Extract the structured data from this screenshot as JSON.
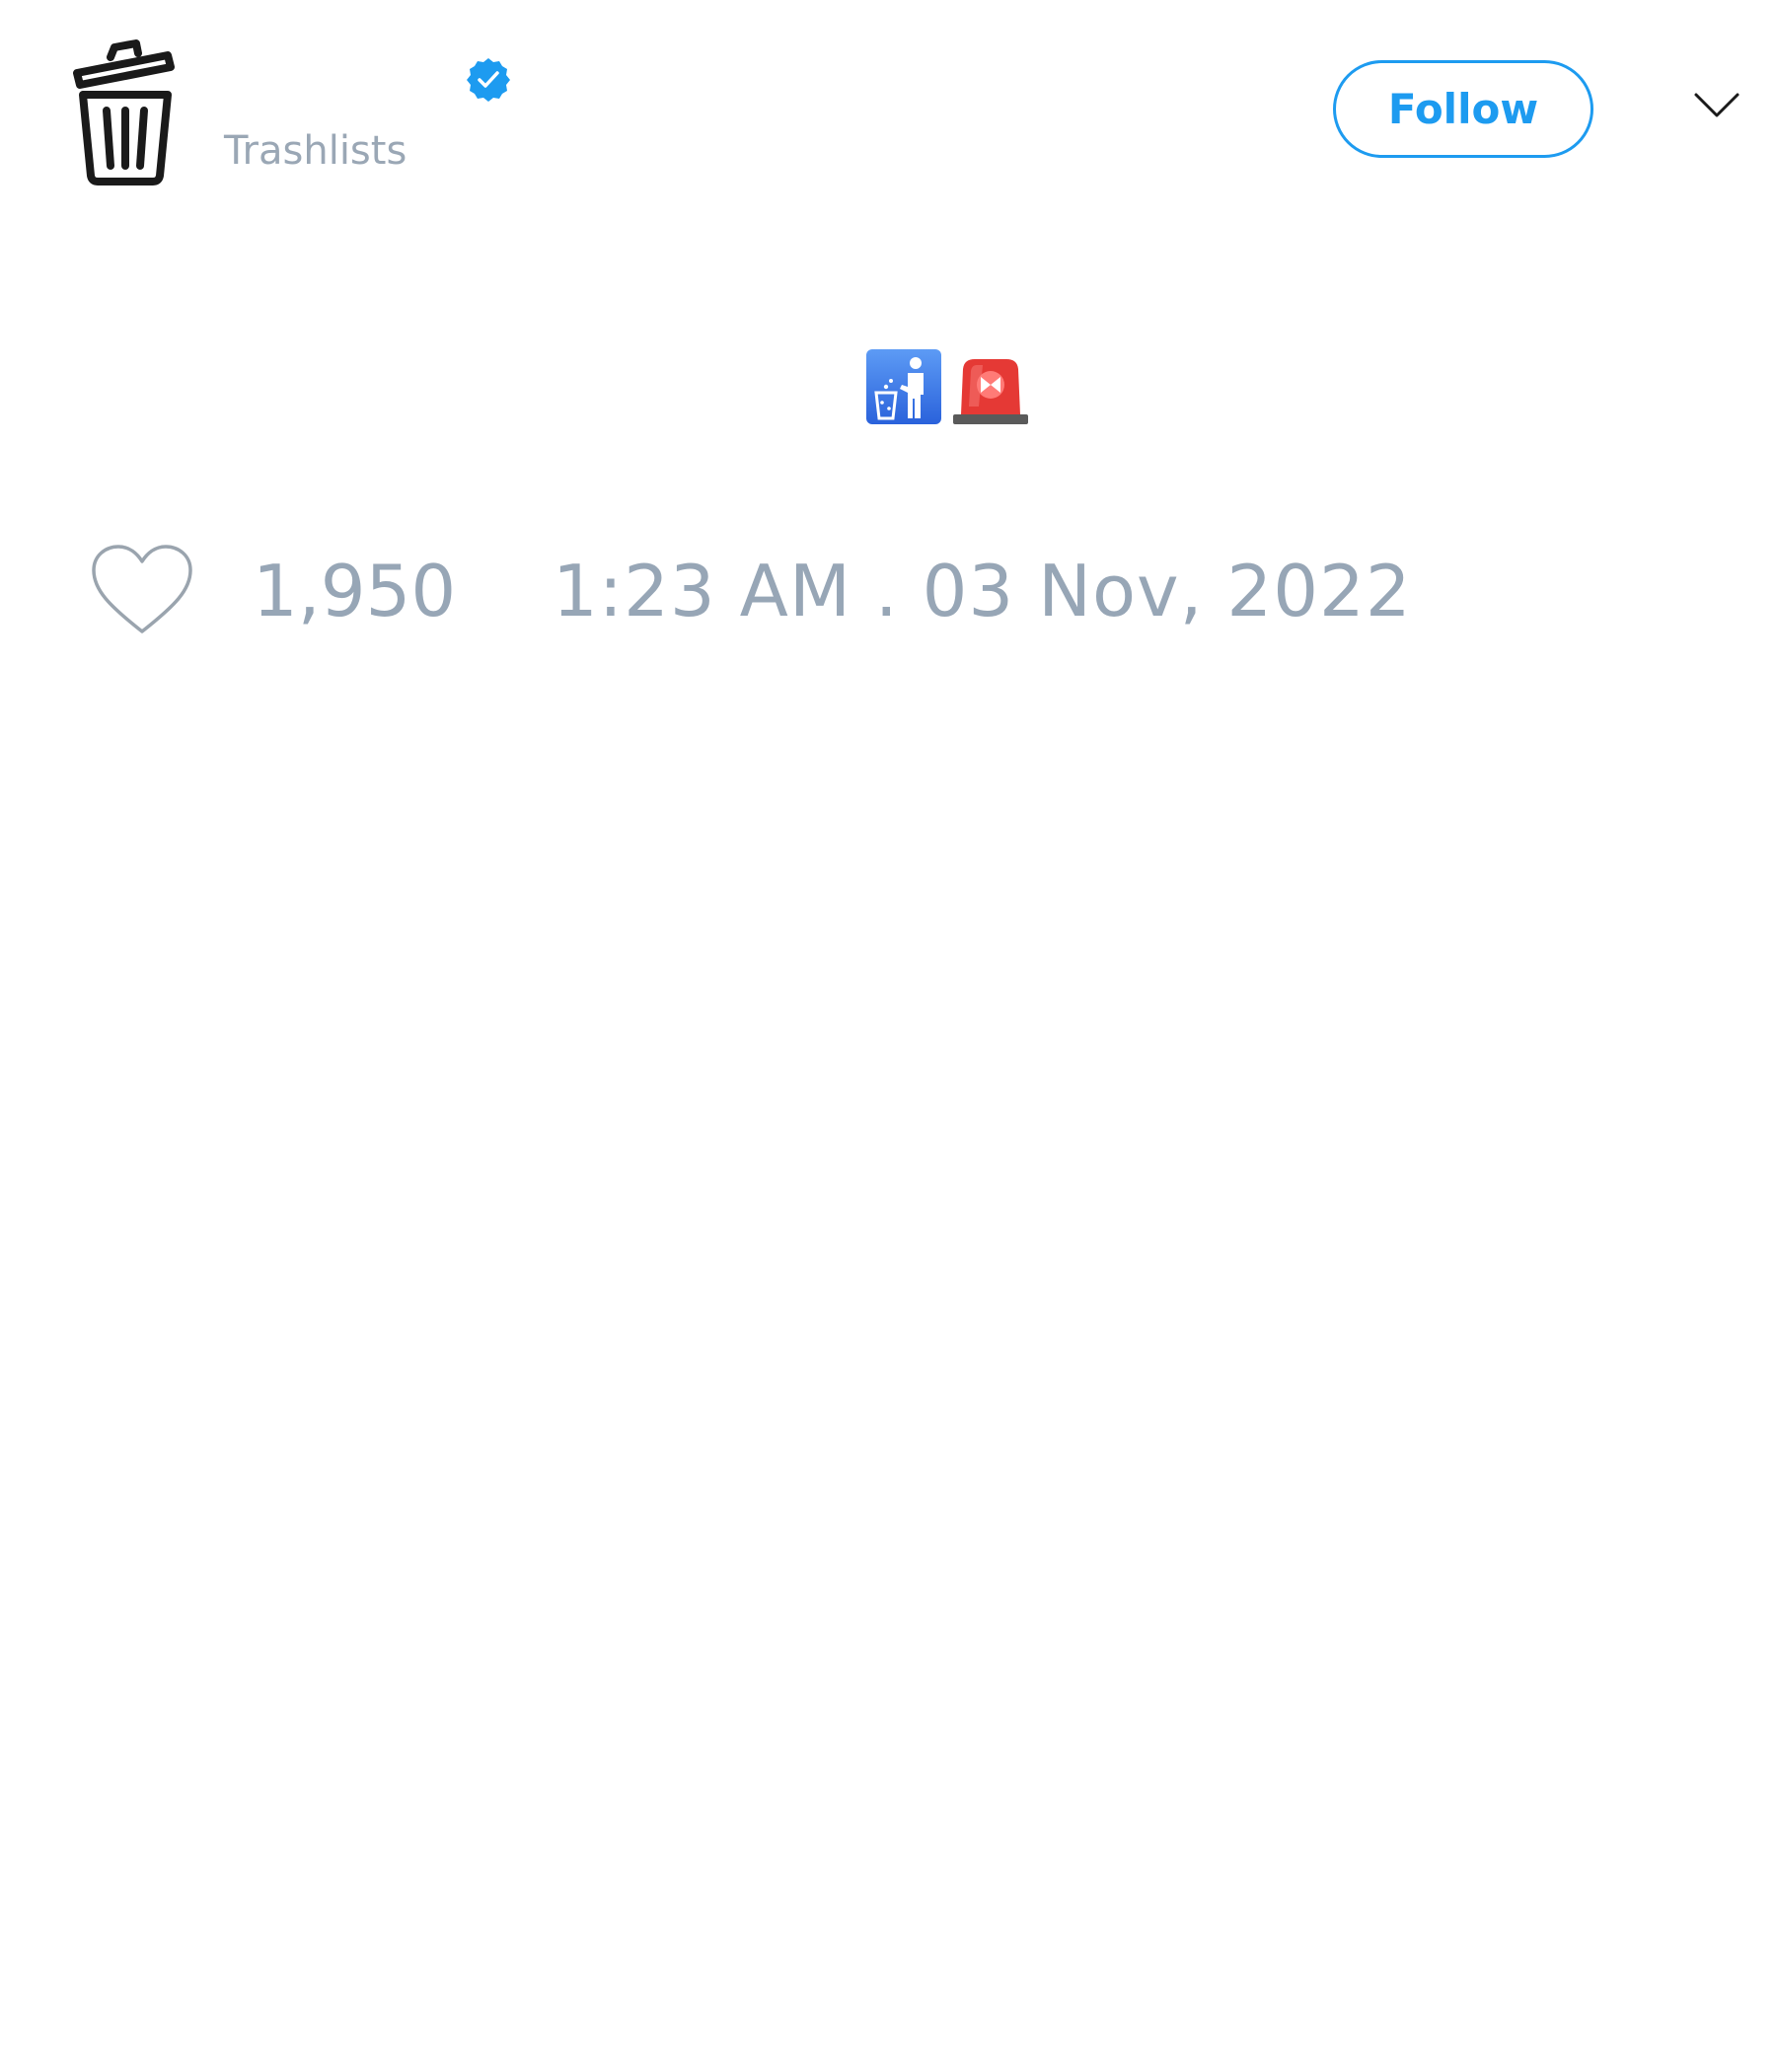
{
  "author": {
    "avatar_icon": "trash-can-icon",
    "verified_icon": "verified-badge-icon",
    "handle": "Trashlists"
  },
  "actions": {
    "follow_label": "Follow",
    "menu_icon": "chevron-down-icon"
  },
  "tweet": {
    "content_icons": [
      "put-litter-in-its-place-icon",
      "police-siren-icon"
    ]
  },
  "footer": {
    "like_icon": "heart-icon",
    "like_count": "1,950",
    "timestamp": "1:23 AM . 03 Nov, 2022"
  },
  "colors": {
    "accent": "#1d9bf0",
    "muted_text": "#97a6b6"
  }
}
